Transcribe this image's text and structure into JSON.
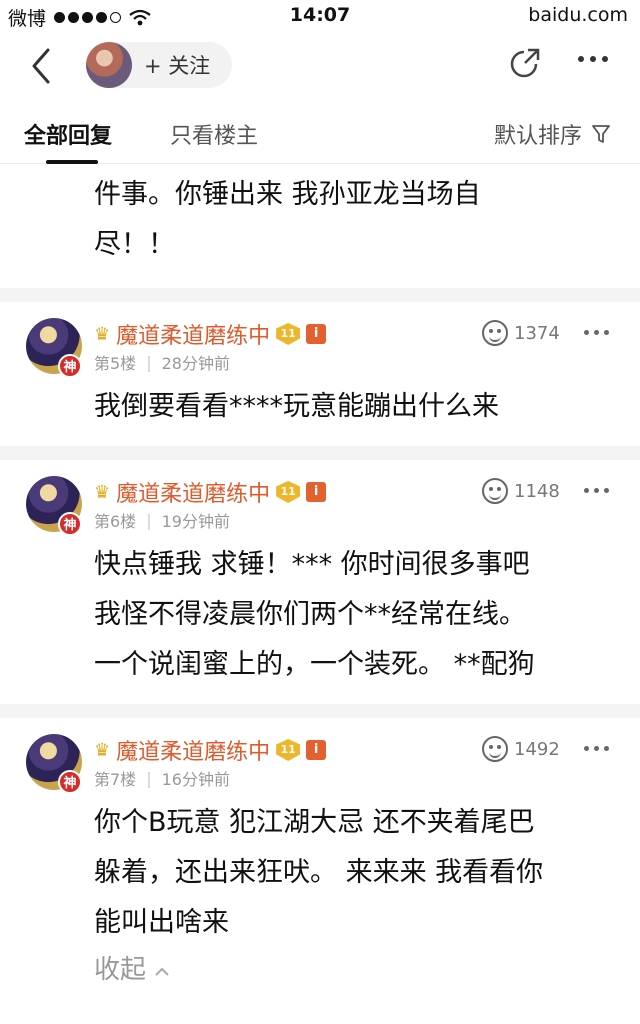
{
  "statusbar": {
    "carrier": "微博",
    "time": "14:07",
    "domain": "baidu.com"
  },
  "navbar": {
    "follow_label": "+ 关注"
  },
  "tabs": {
    "all": "全部回复",
    "owner_only": "只看楼主",
    "sort": "默认排序"
  },
  "continued_post": {
    "lines": [
      "件事。你锤出来 我孙亚龙当场自",
      "尽！！"
    ]
  },
  "posts": [
    {
      "username": "魔道柔道磨练中",
      "level": "11",
      "badge_god": "神",
      "badge_i": "i",
      "floor": "第5楼",
      "time": "28分钟前",
      "likes": "1374",
      "lines": [
        "我倒要看看****玩意能蹦出什么来"
      ]
    },
    {
      "username": "魔道柔道磨练中",
      "level": "11",
      "badge_god": "神",
      "badge_i": "i",
      "floor": "第6楼",
      "time": "19分钟前",
      "likes": "1148",
      "lines": [
        "快点锤我 求锤！*** 你时间很多事吧",
        "我怪不得凌晨你们两个**经常在线。",
        "一个说闺蜜上的，一个装死。 **配狗"
      ]
    },
    {
      "username": "魔道柔道磨练中",
      "level": "11",
      "badge_god": "神",
      "badge_i": "i",
      "floor": "第7楼",
      "time": "16分钟前",
      "likes": "1492",
      "lines": [
        "你个B玩意 犯江湖大忌 还不夹着尾巴",
        "躲着，还出来狂吠。 来来来 我看看你",
        "能叫出啥来"
      ],
      "collapse_label": "收起"
    }
  ],
  "colors": {
    "username": "#e05a2b",
    "accent_badge": "#f0b62a"
  }
}
